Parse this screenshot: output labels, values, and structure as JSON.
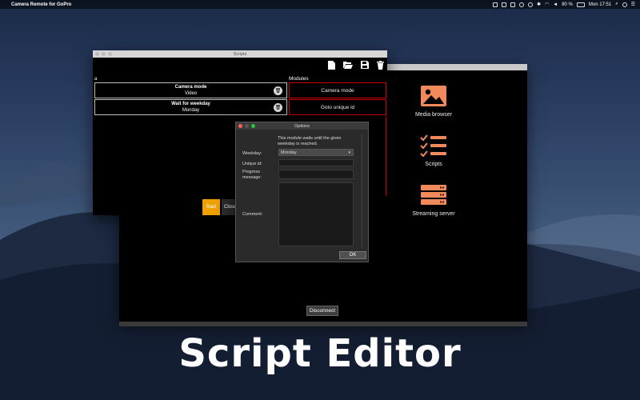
{
  "menubar": {
    "app_name": "Camera Remote for GoPro",
    "battery": "80 %",
    "clock": "Mon 17:51"
  },
  "main_window": {
    "sidebar": [
      {
        "label": "Media browser",
        "icon": "image-icon"
      },
      {
        "label": "Scripts",
        "icon": "checklist-icon"
      },
      {
        "label": "Streaming server",
        "icon": "server-icon"
      }
    ],
    "disconnect_label": "Disconnect",
    "accent": "#f08a5d"
  },
  "scripts_window": {
    "title": "Scripts",
    "script_name": "a",
    "modules_label": "Modules",
    "script_items": [
      {
        "title": "Camera mode",
        "value": "Video"
      },
      {
        "title": "Wait for weekday",
        "value": "Monday"
      }
    ],
    "modules": [
      "Camera mode",
      "Goto unique id"
    ],
    "start_label": "Start",
    "close_label": "Close",
    "accent": "#f0a000"
  },
  "options_dialog": {
    "title": "Options",
    "description": "This module waits until the given weekday is reached.",
    "weekday_label": "Weekday:",
    "weekday_value": "Monday",
    "unique_id_label": "Unique id:",
    "progress_label_1": "Progress",
    "progress_label_2": "message:",
    "comment_label": "Comment:",
    "ok_label": "OK"
  },
  "caption": "Script Editor"
}
